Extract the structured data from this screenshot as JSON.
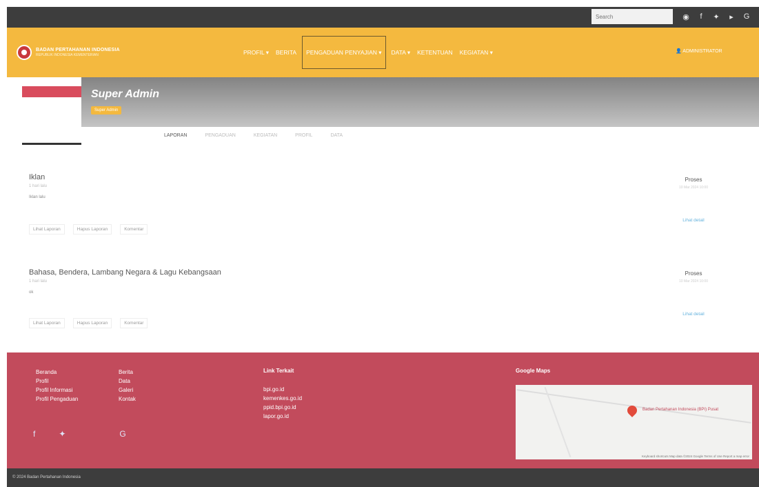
{
  "topbar": {
    "search_placeholder": "Search",
    "social_icons": [
      "instagram-icon",
      "facebook-icon",
      "twitter-icon",
      "youtube-icon",
      "google-icon"
    ]
  },
  "nav": {
    "logo_line1": "BADAN PERTAHANAN INDONESIA",
    "logo_line2": "REPUBLIK INDONESIA KEMENTERIAN",
    "menu": [
      {
        "label": "PROFIL ▾"
      },
      {
        "label": "BERITA"
      },
      {
        "label": "PENGADUAN PENYAJIAN ▾"
      },
      {
        "label": "DATA ▾"
      },
      {
        "label": "KETENTUAN"
      },
      {
        "label": "KEGIATAN ▾"
      }
    ],
    "user": "ADMINISTRATOR"
  },
  "profile": {
    "name": "Super Admin",
    "role": "Super Admin",
    "tabs": [
      "LAPORAN",
      "PENGADUAN",
      "KEGIATAN",
      "PROFIL",
      "DATA"
    ]
  },
  "posts": [
    {
      "title": "Iklan",
      "subtitle": "1 hari lalu",
      "body": "Iklan lalu",
      "actions": [
        "Lihat Laporan",
        "Hapus Laporan",
        "Komentar"
      ],
      "status": "Proses",
      "status_date": "10 Mar 2024 10:00",
      "link": "Lihat detail"
    },
    {
      "title": "Bahasa, Bendera, Lambang Negara & Lagu Kebangsaan",
      "subtitle": "1 hari lalu",
      "body": "ok",
      "actions": [
        "Lihat Laporan",
        "Hapus Laporan",
        "Komentar"
      ],
      "status": "Proses",
      "status_date": "10 Mar 2024 10:00",
      "link": "Lihat detail"
    }
  ],
  "footer": {
    "col1_heading": "Beranda",
    "col1": [
      "Profil",
      "Profil Informasi",
      "Profil Pengaduan"
    ],
    "col2_heading": "Berita",
    "col2": [
      "Data",
      "Galeri",
      "Kontak"
    ],
    "links_heading": "Link Terkait",
    "links": [
      "bpi.go.id",
      "kemenkes.go.id",
      "ppid.bpi.go.id",
      "lapor.go.id"
    ],
    "map_heading": "Google Maps",
    "map_label": "Badan Pertahanan Indonesia (BPI) Pusat",
    "map_attribution": "Keyboard shortcuts  Map data ©2024 Google  Terms of Use  Report a map error",
    "icons": [
      "facebook-icon",
      "twitter-icon",
      "google-icon"
    ]
  },
  "copyright": "© 2024 Badan Pertahanan Indonesia"
}
